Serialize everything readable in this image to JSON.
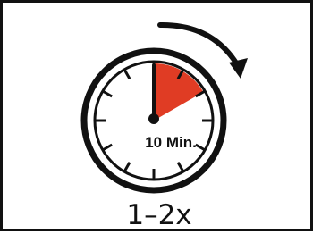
{
  "timer": {
    "duration_label": "10 Min.",
    "repeat_label": "1–2x",
    "icon": "stopwatch-icon",
    "rotation_icon": "clockwise-arrow-icon",
    "elapsed_fraction": 0.1667
  },
  "colors": {
    "segment": "#e03c24",
    "ink": "#111111",
    "background": "#ffffff"
  }
}
